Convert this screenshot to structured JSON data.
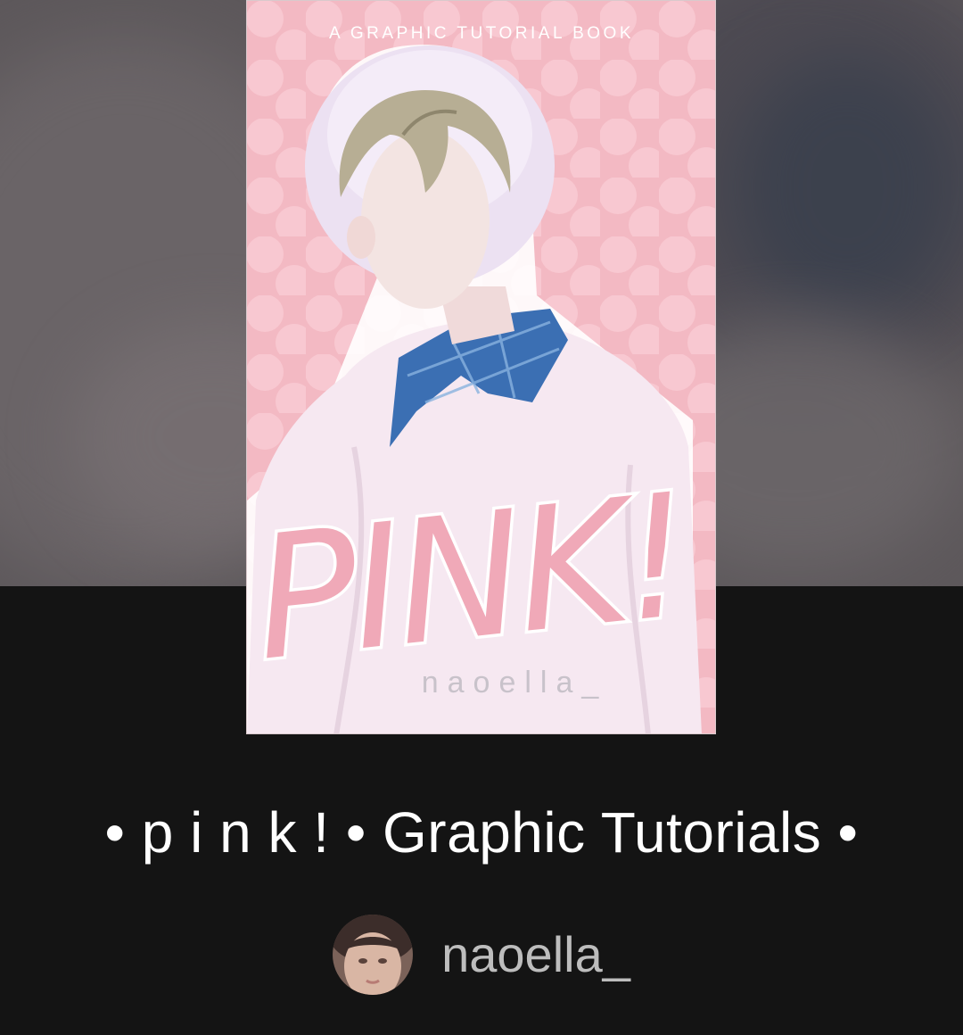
{
  "story": {
    "title": "• p i n k ! • Graphic Tutorials •",
    "cover": {
      "kicker": "A GRAPHIC TUTORIAL BOOK",
      "logo_text": "PINK!",
      "author_tag": "naoella_"
    }
  },
  "author": {
    "name": "naoella_",
    "avatar_icon": "user-avatar-photo"
  },
  "colors": {
    "background": "#141414",
    "title_text": "#ffffff",
    "author_text": "#bdbdbd",
    "cover_pink": "#f3b9c3"
  }
}
